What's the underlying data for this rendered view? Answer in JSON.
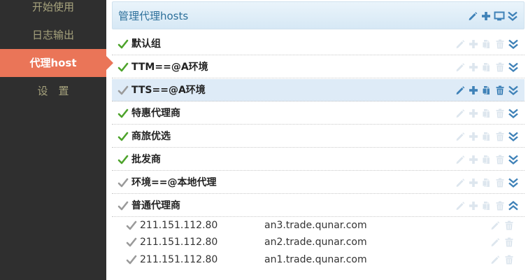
{
  "colors": {
    "sidebar_bg": "#2f2f2f",
    "sidebar_text": "#a7a37d",
    "active_bg": "#ea7558",
    "header_bg": "#d6e8f5",
    "title_text": "#2c6f9a",
    "icon_active": "#3f82b8",
    "icon_faded": "#dde6ee",
    "check_green": "#4da32b",
    "check_gray": "#9a9a9a"
  },
  "sidebar": {
    "items": [
      {
        "label": "开始使用"
      },
      {
        "label": "日志输出"
      },
      {
        "label": "代理host",
        "active": true
      },
      {
        "label": "设　置"
      }
    ]
  },
  "header": {
    "title": "管理代理hosts",
    "tools": [
      "pencil-icon",
      "plus-icon",
      "monitor-icon",
      "chevron-double-down-icon"
    ]
  },
  "groups": [
    {
      "name": "默认组",
      "checked": true,
      "selected": false,
      "expanded": false
    },
    {
      "name": "TTM==@A环境",
      "checked": true,
      "selected": false,
      "expanded": false
    },
    {
      "name": "TTS==@A环境",
      "checked": false,
      "selected": true,
      "expanded": false
    },
    {
      "name": "特惠代理商",
      "checked": true,
      "selected": false,
      "expanded": false
    },
    {
      "name": "商旅优选",
      "checked": true,
      "selected": false,
      "expanded": false
    },
    {
      "name": "批发商",
      "checked": true,
      "selected": false,
      "expanded": false
    },
    {
      "name": "环境==@本地代理",
      "checked": false,
      "selected": false,
      "expanded": false
    },
    {
      "name": "普通代理商",
      "checked": false,
      "selected": false,
      "expanded": true
    }
  ],
  "hosts": [
    {
      "ip": "211.151.112.80",
      "domain": "an3.trade.qunar.com"
    },
    {
      "ip": "211.151.112.80",
      "domain": "an2.trade.qunar.com"
    },
    {
      "ip": "211.151.112.80",
      "domain": "an1.trade.qunar.com"
    }
  ]
}
